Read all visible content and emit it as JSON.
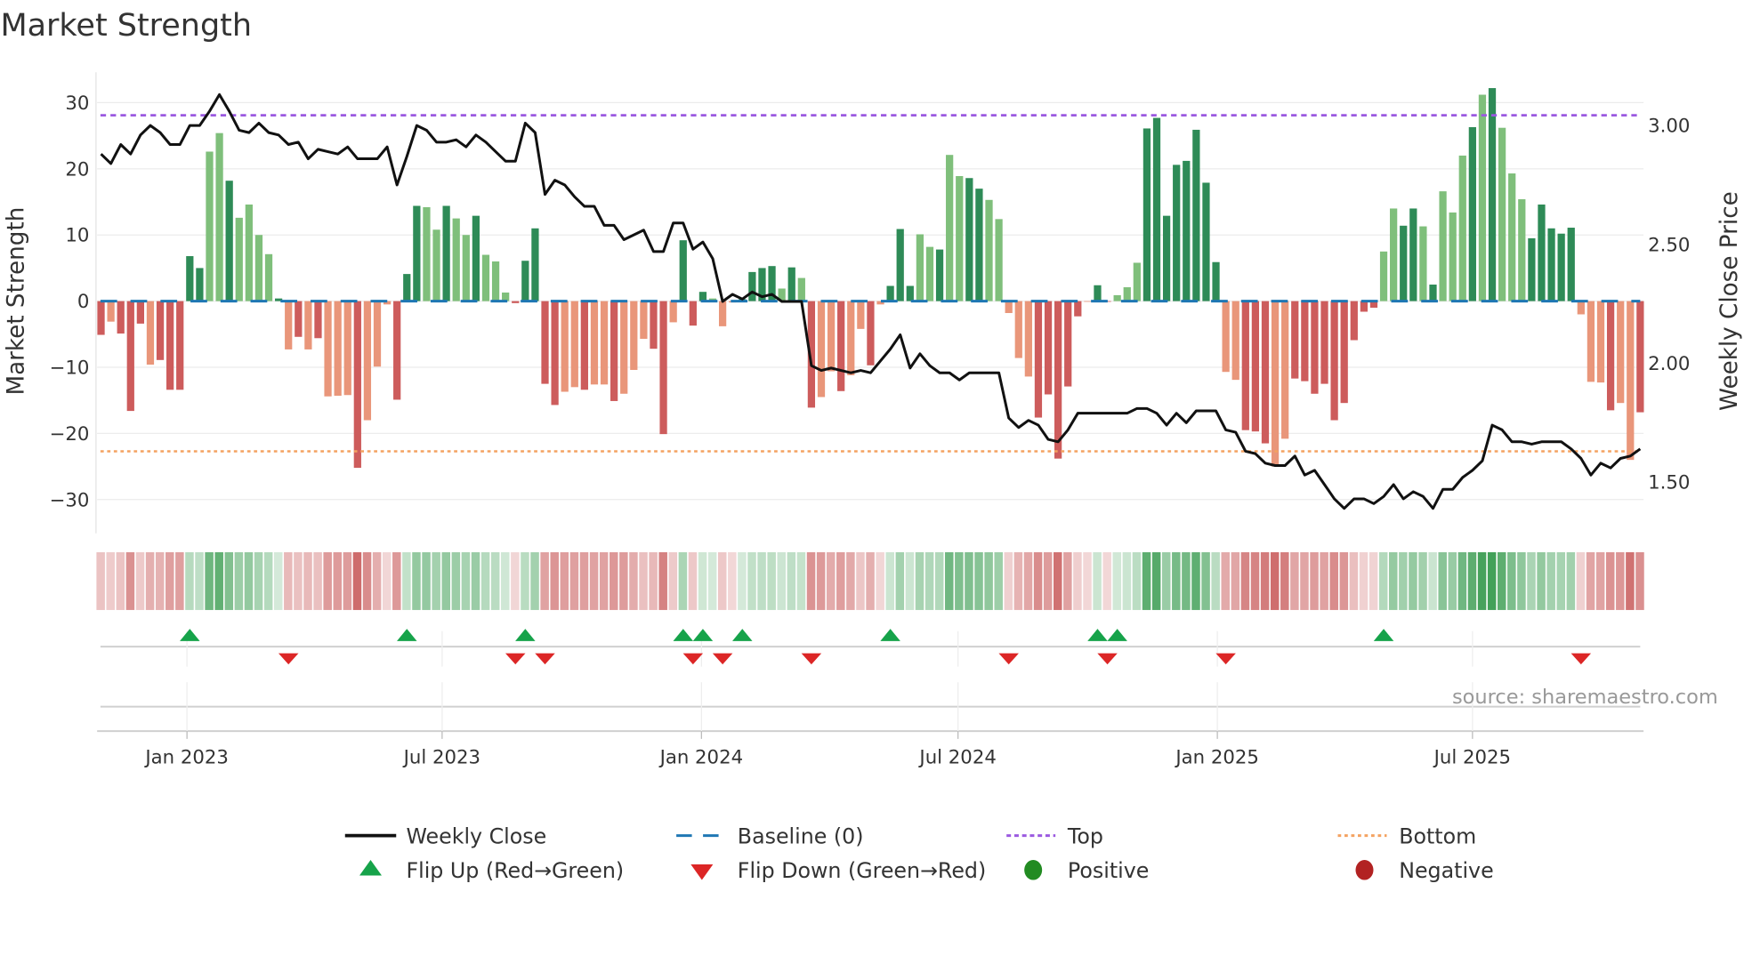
{
  "title": "Market Strength",
  "source": "source: sharemaestro.com",
  "chart_data": {
    "type": "bar+line",
    "title": "Market Strength",
    "frequency": "weekly",
    "start_date": "2022-11-01",
    "ylabel_left": "Market Strength",
    "ylabel_right": "Weekly Close Price",
    "ylim_left": [
      -35.1,
      34.6
    ],
    "ylim_right": [
      1.285,
      3.224
    ],
    "yticks_left": [
      {
        "v": 30,
        "label": "30"
      },
      {
        "v": 20,
        "label": "20"
      },
      {
        "v": 10,
        "label": "10"
      },
      {
        "v": 0,
        "label": "0"
      },
      {
        "v": -10,
        "label": "−10"
      },
      {
        "v": -20,
        "label": "−20"
      },
      {
        "v": -30,
        "label": "−30"
      }
    ],
    "yticks_right": [
      {
        "v": 3.0,
        "label": "3.00"
      },
      {
        "v": 2.5,
        "label": "2.50"
      },
      {
        "v": 2.0,
        "label": "2.00"
      },
      {
        "v": 1.5,
        "label": "1.50"
      }
    ],
    "xticks": [
      {
        "date": "2023-01-01",
        "label": "Jan 2023"
      },
      {
        "date": "2023-07-01",
        "label": "Jul 2023"
      },
      {
        "date": "2024-01-01",
        "label": "Jan 2024"
      },
      {
        "date": "2024-07-01",
        "label": "Jul 2024"
      },
      {
        "date": "2025-01-01",
        "label": "Jan 2025"
      },
      {
        "date": "2025-07-01",
        "label": "Jul 2025"
      }
    ],
    "top_level": 28.1,
    "bottom_level": -22.7,
    "baseline": 0,
    "strength": [
      -5.1,
      -3.1,
      -4.9,
      -16.6,
      -3.4,
      -9.6,
      -8.9,
      -13.4,
      -13.4,
      6.8,
      5.0,
      22.6,
      25.4,
      18.2,
      12.6,
      14.6,
      10,
      7.1,
      0.4,
      -7.3,
      -5.4,
      -7.3,
      -5.6,
      -14.4,
      -14.3,
      -14.2,
      -25.2,
      -18,
      -9.9,
      -0.5,
      -14.9,
      4.1,
      14.4,
      14.2,
      10.8,
      14.4,
      12.5,
      10,
      12.9,
      7,
      6,
      1.3,
      -0.3,
      6.1,
      11,
      -12.5,
      -15.7,
      -13.7,
      -13,
      -13.4,
      -12.6,
      -12.6,
      -15.1,
      -14,
      -10.4,
      -5.7,
      -7.2,
      -20.1,
      -3.2,
      9.2,
      -3.7,
      1.4,
      0.4,
      -3.8,
      -0.2,
      0.3,
      4.4,
      5,
      5.3,
      1.9,
      5.1,
      3.5,
      -16.1,
      -14.5,
      -10.6,
      -13.6,
      -11.2,
      -4.2,
      -9.7,
      -0.5,
      2.3,
      10.9,
      2.3,
      10.1,
      8.2,
      7.8,
      22.1,
      18.9,
      18.6,
      17,
      15.3,
      12.4,
      -1.8,
      -8.6,
      -11.4,
      -17.6,
      -14.1,
      -23.8,
      -12.9,
      -2.3,
      -0.1,
      2.4,
      -0.1,
      0.9,
      2.1,
      5.8,
      26.1,
      27.7,
      12.9,
      20.6,
      21.2,
      25.9,
      17.9,
      5.9,
      -10.7,
      -11.9,
      -19.5,
      -19.7,
      -21.5,
      -25,
      -20.8,
      -11.7,
      -12.1,
      -14,
      -12.5,
      -18,
      -15.4,
      -5.9,
      -1.6,
      -1,
      7.5,
      14,
      11.4,
      14,
      11.3,
      2.5,
      16.6,
      13.4,
      22,
      26.3,
      31.2,
      32.2,
      26.2,
      19.3,
      15.4,
      9.5,
      14.6,
      11,
      10.2,
      11.1,
      -2,
      -12.2,
      -12.3,
      -16.5,
      -15.4,
      -24,
      -16.8
    ],
    "shade": "dldddldddddlldlllldldldllldllldddlldlldllldddddlldlldlllddldddlllddddldldlldlldldddlldllddllllldddddlddlllddddddddlldddlldddddddddllddldllldldllldddddllldlldddddldld",
    "weekly_close": [
      2.88,
      2.84,
      2.92,
      2.88,
      2.96,
      3.0,
      2.97,
      2.92,
      2.92,
      3.0,
      3.0,
      3.06,
      3.13,
      3.06,
      2.98,
      2.97,
      3.01,
      2.97,
      2.96,
      2.92,
      2.93,
      2.86,
      2.9,
      2.89,
      2.88,
      2.91,
      2.86,
      2.86,
      2.86,
      2.91,
      2.75,
      2.87,
      3.0,
      2.98,
      2.93,
      2.93,
      2.94,
      2.91,
      2.96,
      2.93,
      2.89,
      2.85,
      2.85,
      3.01,
      2.97,
      2.71,
      2.77,
      2.75,
      2.7,
      2.66,
      2.66,
      2.58,
      2.58,
      2.52,
      2.54,
      2.56,
      2.47,
      2.47,
      2.59,
      2.59,
      2.48,
      2.51,
      2.44,
      2.26,
      2.29,
      2.27,
      2.3,
      2.28,
      2.29,
      2.26,
      2.26,
      2.26,
      1.99,
      1.97,
      1.98,
      1.97,
      1.96,
      1.97,
      1.96,
      2.01,
      2.06,
      2.12,
      1.98,
      2.04,
      1.99,
      1.96,
      1.96,
      1.93,
      1.96,
      1.96,
      1.96,
      1.96,
      1.77,
      1.73,
      1.76,
      1.74,
      1.68,
      1.67,
      1.72,
      1.79,
      1.79,
      1.79,
      1.79,
      1.79,
      1.79,
      1.81,
      1.81,
      1.79,
      1.74,
      1.79,
      1.75,
      1.8,
      1.8,
      1.8,
      1.72,
      1.71,
      1.63,
      1.62,
      1.58,
      1.57,
      1.57,
      1.61,
      1.53,
      1.55,
      1.49,
      1.43,
      1.39,
      1.43,
      1.43,
      1.41,
      1.44,
      1.49,
      1.43,
      1.46,
      1.44,
      1.39,
      1.47,
      1.47,
      1.52,
      1.55,
      1.59,
      1.74,
      1.72,
      1.67,
      1.67,
      1.66,
      1.67,
      1.67,
      1.67,
      1.64,
      1.6,
      1.53,
      1.58,
      1.56,
      1.6,
      1.61,
      1.64
    ],
    "flip_up_weeks": [
      9,
      31,
      43,
      59,
      61,
      65,
      80,
      101,
      103,
      130
    ],
    "flip_down_weeks": [
      19,
      42,
      45,
      60,
      63,
      72,
      92,
      102,
      114,
      150
    ],
    "colors": {
      "green_dark": "#2e8b57",
      "green_light": "#7fbf7b",
      "red_dark": "#cd5c5c",
      "red_light": "#e9967a",
      "close": "#111111",
      "baseline": "#1f77b4",
      "top": "#9b59e0",
      "bottom": "#f4a261",
      "flip_up": "#16a34a",
      "flip_down": "#dc2626",
      "positive": "#228b22",
      "negative": "#b22222"
    },
    "legend": [
      {
        "key": "close",
        "label": "Weekly Close"
      },
      {
        "key": "baseline",
        "label": "Baseline (0)"
      },
      {
        "key": "top",
        "label": "Top"
      },
      {
        "key": "bottom",
        "label": "Bottom"
      },
      {
        "key": "flip_up",
        "label": "Flip Up (Red→Green)"
      },
      {
        "key": "flip_down",
        "label": "Flip Down (Green→Red)"
      },
      {
        "key": "positive",
        "label": "Positive"
      },
      {
        "key": "negative",
        "label": "Negative"
      }
    ],
    "legend_placement": "bottom"
  }
}
